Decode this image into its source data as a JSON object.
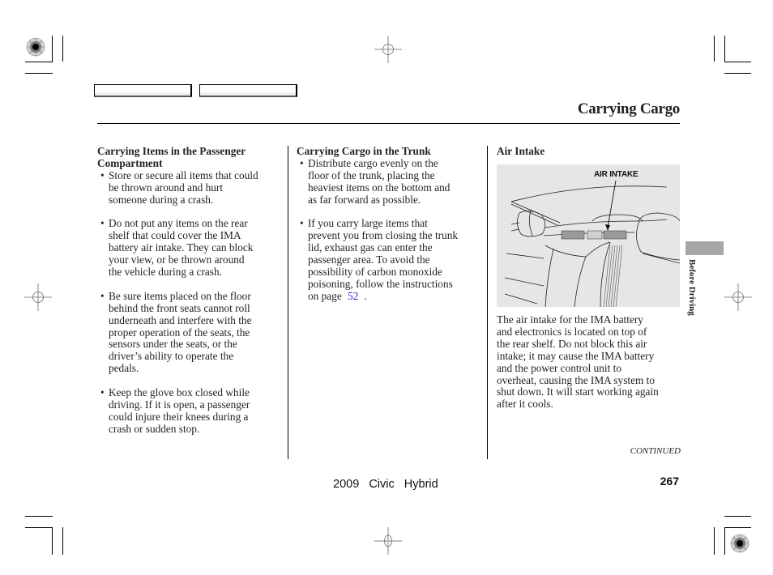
{
  "header": {
    "nav_buttons": [
      {
        "label": ""
      },
      {
        "label": ""
      }
    ],
    "page_title": "Carrying Cargo"
  },
  "columns": {
    "passenger": {
      "heading_line1": "Carrying Items in the Passenger",
      "heading_line2": "Compartment",
      "bullets": [
        {
          "lines": [
            "Store or secure all items that could",
            "be thrown around and hurt",
            "someone during a crash."
          ]
        },
        {
          "lines": [
            "Do not put any items on the rear",
            "shelf that could cover the IMA",
            "battery air intake. They can block",
            "your view, or be thrown around",
            "the vehicle during a crash."
          ]
        },
        {
          "lines": [
            "Be sure items placed on the floor",
            "behind the front seats cannot roll",
            "underneath and interfere with the",
            "proper operation of the seats, the",
            "sensors under the seats, or the",
            "driver’s ability to operate the",
            "pedals."
          ]
        },
        {
          "lines": [
            "Keep the glove box closed while",
            "driving. If it is open, a passenger",
            "could injure their knees during a",
            "crash or sudden stop."
          ]
        }
      ]
    },
    "trunk": {
      "heading": "Carrying Cargo in the Trunk",
      "bullets": [
        {
          "lines": [
            "Distribute cargo evenly on the",
            "floor of the trunk, placing the",
            "heaviest items on the bottom and",
            "as far forward as possible."
          ]
        },
        {
          "lines": [
            "If you carry large items that",
            "prevent you from closing the trunk",
            "lid, exhaust gas can enter the",
            "passenger area. To avoid the",
            "possibility of carbon monoxide",
            "poisoning, follow the instructions"
          ],
          "last_line_prefix": "on page ",
          "page_link": "52",
          "last_line_suffix": " ."
        }
      ]
    },
    "air_intake": {
      "heading": "Air Intake",
      "figure_label": "AIR INTAKE",
      "body_lines": [
        "The air intake for the IMA battery",
        "and electronics is located on top of",
        "the rear shelf. Do not block this air",
        "intake; it may cause the IMA battery",
        "and the power control unit to",
        "overheat, causing the IMA system to",
        "shut down. It will start working again",
        "after it cools."
      ]
    }
  },
  "side_tab": {
    "label": "Before Driving",
    "color": "#a7a7a7"
  },
  "footer": {
    "continued": "CONTINUED",
    "model": "2009  Civic  Hybrid",
    "page_number": "267"
  },
  "colors": {
    "link": "#1a2bd6",
    "figure_bg": "#e6e6e6",
    "text": "#231f20"
  }
}
